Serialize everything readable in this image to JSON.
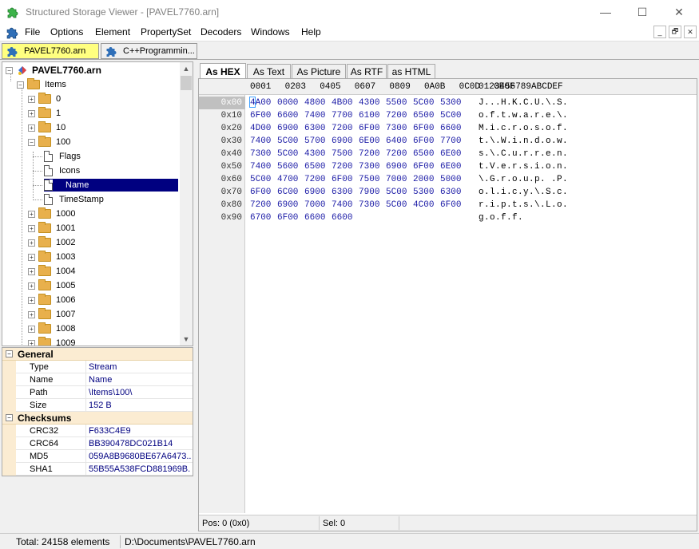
{
  "window": {
    "title": "Structured Storage Viewer - [PAVEL7760.arn]",
    "icon": "puzzle-piece-icon",
    "minimize_glyph": "—",
    "maximize_glyph": "☐",
    "close_glyph": "✕"
  },
  "menu": {
    "items": [
      "File",
      "Options",
      "Element",
      "PropertySet",
      "Decoders",
      "Windows",
      "Help"
    ],
    "mdi_minimize": "_",
    "mdi_restore": "🗗",
    "mdi_close": "✕"
  },
  "doc_tabs": [
    {
      "label": "PAVEL7760.arn",
      "active": true
    },
    {
      "label": "C++Programmin...",
      "active": false
    }
  ],
  "tree": {
    "root": "PAVEL7760.arn",
    "items_label": "Items",
    "nodes": [
      {
        "label": "0",
        "type": "folder",
        "expander": "+"
      },
      {
        "label": "1",
        "type": "folder",
        "expander": "+"
      },
      {
        "label": "10",
        "type": "folder",
        "expander": "+"
      },
      {
        "label": "100",
        "type": "folder",
        "expander": "−"
      },
      {
        "label": "Flags",
        "type": "file"
      },
      {
        "label": "Icons",
        "type": "file"
      },
      {
        "label": "Name",
        "type": "file",
        "selected": true
      },
      {
        "label": "TimeStamp",
        "type": "file"
      },
      {
        "label": "1000",
        "type": "folder",
        "expander": "+"
      },
      {
        "label": "1001",
        "type": "folder",
        "expander": "+"
      },
      {
        "label": "1002",
        "type": "folder",
        "expander": "+"
      },
      {
        "label": "1003",
        "type": "folder",
        "expander": "+"
      },
      {
        "label": "1004",
        "type": "folder",
        "expander": "+"
      },
      {
        "label": "1005",
        "type": "folder",
        "expander": "+"
      },
      {
        "label": "1006",
        "type": "folder",
        "expander": "+"
      },
      {
        "label": "1007",
        "type": "folder",
        "expander": "+"
      },
      {
        "label": "1008",
        "type": "folder",
        "expander": "+"
      },
      {
        "label": "1009",
        "type": "folder",
        "expander": "+"
      }
    ]
  },
  "properties": {
    "general_label": "General",
    "general": [
      {
        "key": "Type",
        "value": "Stream"
      },
      {
        "key": "Name",
        "value": "Name"
      },
      {
        "key": "Path",
        "value": "\\Items\\100\\"
      },
      {
        "key": "Size",
        "value": "152 B"
      }
    ],
    "checksums_label": "Checksums",
    "checksums": [
      {
        "key": "CRC32",
        "value": "F633C4E9"
      },
      {
        "key": "CRC64",
        "value": "BB390478DC021B14"
      },
      {
        "key": "MD5",
        "value": "059A8B9680BE67A6473..."
      },
      {
        "key": "SHA1",
        "value": "55B55A538FCD881969B..."
      }
    ]
  },
  "viewer_tabs": [
    "As HEX",
    "As Text",
    "As Picture",
    "As RTF",
    "as HTML"
  ],
  "hex": {
    "header_cols": [
      "0001",
      "0203",
      "0405",
      "0607",
      "0809",
      "0A0B",
      "0C0D",
      "0E0F"
    ],
    "header_ascii": "0123456789ABCDEF",
    "rows": [
      {
        "offset": "0x00",
        "bytes": "4A00 0000 4800 4B00 4300 5500 5C00 5300",
        "ascii": "J...H.K.C.U.\\.S."
      },
      {
        "offset": "0x10",
        "bytes": "6F00 6600 7400 7700 6100 7200 6500 5C00",
        "ascii": "o.f.t.w.a.r.e.\\."
      },
      {
        "offset": "0x20",
        "bytes": "4D00 6900 6300 7200 6F00 7300 6F00 6600",
        "ascii": "M.i.c.r.o.s.o.f."
      },
      {
        "offset": "0x30",
        "bytes": "7400 5C00 5700 6900 6E00 6400 6F00 7700",
        "ascii": "t.\\.W.i.n.d.o.w."
      },
      {
        "offset": "0x40",
        "bytes": "7300 5C00 4300 7500 7200 7200 6500 6E00",
        "ascii": "s.\\.C.u.r.r.e.n."
      },
      {
        "offset": "0x50",
        "bytes": "7400 5600 6500 7200 7300 6900 6F00 6E00",
        "ascii": "t.V.e.r.s.i.o.n."
      },
      {
        "offset": "0x60",
        "bytes": "5C00 4700 7200 6F00 7500 7000 2000 5000",
        "ascii": "\\.G.r.o.u.p. .P."
      },
      {
        "offset": "0x70",
        "bytes": "6F00 6C00 6900 6300 7900 5C00 5300 6300",
        "ascii": "o.l.i.c.y.\\.S.c."
      },
      {
        "offset": "0x80",
        "bytes": "7200 6900 7000 7400 7300 5C00 4C00 6F00",
        "ascii": "r.i.p.t.s.\\.L.o."
      },
      {
        "offset": "0x90",
        "bytes": "6700 6F00 6600 6600",
        "ascii": "g.o.f.f."
      }
    ],
    "status_pos": "Pos: 0 (0x0)",
    "status_sel": "Sel: 0"
  },
  "statusbar": {
    "total": "Total: 24158 elements",
    "path": "D:\\Documents\\PAVEL7760.arn"
  }
}
